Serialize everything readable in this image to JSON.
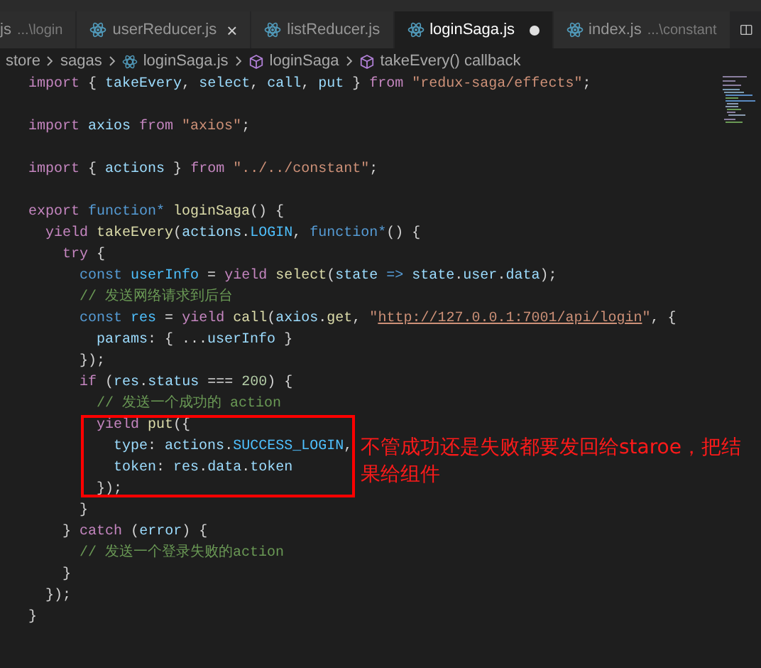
{
  "tabs": [
    {
      "label": "js",
      "path": "...\\login",
      "icon": false,
      "selected": false,
      "dirty": false
    },
    {
      "label": "userReducer.js",
      "icon": true,
      "close": "×",
      "selected": false,
      "dirty": false
    },
    {
      "label": "listReducer.js",
      "icon": true,
      "selected": false,
      "dirty": false
    },
    {
      "label": "loginSaga.js",
      "icon": true,
      "selected": true,
      "dirty": true
    },
    {
      "label": "index.js",
      "path": "...\\constant",
      "icon": true,
      "selected": false,
      "dirty": false
    }
  ],
  "breadcrumbs": [
    {
      "label": "store",
      "kind": "folder"
    },
    {
      "label": "sagas",
      "kind": "folder"
    },
    {
      "label": "loginSaga.js",
      "kind": "file"
    },
    {
      "label": "loginSaga",
      "kind": "symbol"
    },
    {
      "label": "takeEvery() callback",
      "kind": "symbol"
    }
  ],
  "code": [
    {
      "kind": "code",
      "tokens": [
        {
          "kind": "kw",
          "text": "import "
        },
        {
          "kind": "p",
          "text": "{ "
        },
        {
          "kind": "v",
          "text": "takeEvery"
        },
        {
          "kind": "p",
          "text": ", "
        },
        {
          "kind": "v",
          "text": "select"
        },
        {
          "kind": "p",
          "text": ", "
        },
        {
          "kind": "v",
          "text": "call"
        },
        {
          "kind": "p",
          "text": ", "
        },
        {
          "kind": "v",
          "text": "put"
        },
        {
          "kind": "p",
          "text": " } "
        },
        {
          "kind": "kw",
          "text": "from "
        },
        {
          "kind": "s",
          "text": "\"redux-saga/effects\""
        },
        {
          "kind": "p",
          "text": ";"
        }
      ]
    },
    {
      "kind": "blank"
    },
    {
      "kind": "code",
      "tokens": [
        {
          "kind": "kw",
          "text": "import "
        },
        {
          "kind": "v",
          "text": "axios "
        },
        {
          "kind": "kw",
          "text": "from "
        },
        {
          "kind": "s",
          "text": "\"axios\""
        },
        {
          "kind": "p",
          "text": ";"
        }
      ]
    },
    {
      "kind": "blank"
    },
    {
      "kind": "code",
      "tokens": [
        {
          "kind": "kw",
          "text": "import "
        },
        {
          "kind": "p",
          "text": "{ "
        },
        {
          "kind": "v",
          "text": "actions"
        },
        {
          "kind": "p",
          "text": " } "
        },
        {
          "kind": "kw",
          "text": "from "
        },
        {
          "kind": "s",
          "text": "\"../../constant\""
        },
        {
          "kind": "p",
          "text": ";"
        }
      ]
    },
    {
      "kind": "blank"
    },
    {
      "kind": "code",
      "tokens": [
        {
          "kind": "kw",
          "text": "export "
        },
        {
          "kind": "b",
          "text": "function* "
        },
        {
          "kind": "f",
          "text": "loginSaga"
        },
        {
          "kind": "p",
          "text": "() {"
        }
      ]
    },
    {
      "kind": "code",
      "tokens": [
        {
          "kind": "kw",
          "text": "  yield "
        },
        {
          "kind": "f",
          "text": "takeEvery"
        },
        {
          "kind": "p",
          "text": "("
        },
        {
          "kind": "v",
          "text": "actions"
        },
        {
          "kind": "p",
          "text": "."
        },
        {
          "kind": "c",
          "text": "LOGIN"
        },
        {
          "kind": "p",
          "text": ", "
        },
        {
          "kind": "b",
          "text": "function*"
        },
        {
          "kind": "p",
          "text": "() {"
        }
      ]
    },
    {
      "kind": "code",
      "tokens": [
        {
          "kind": "kw",
          "text": "    try"
        },
        {
          "kind": "p",
          "text": " {"
        }
      ]
    },
    {
      "kind": "code",
      "tokens": [
        {
          "kind": "b",
          "text": "      const "
        },
        {
          "kind": "c",
          "text": "userInfo"
        },
        {
          "kind": "p",
          "text": " = "
        },
        {
          "kind": "kw",
          "text": "yield "
        },
        {
          "kind": "f",
          "text": "select"
        },
        {
          "kind": "p",
          "text": "("
        },
        {
          "kind": "v",
          "text": "state "
        },
        {
          "kind": "b",
          "text": "=> "
        },
        {
          "kind": "v",
          "text": "state"
        },
        {
          "kind": "p",
          "text": "."
        },
        {
          "kind": "v",
          "text": "user"
        },
        {
          "kind": "p",
          "text": "."
        },
        {
          "kind": "v",
          "text": "data"
        },
        {
          "kind": "p",
          "text": ");"
        }
      ]
    },
    {
      "kind": "code",
      "tokens": [
        {
          "kind": "com",
          "text": "      // 发送网络请求到后台"
        }
      ]
    },
    {
      "kind": "code",
      "tokens": [
        {
          "kind": "b",
          "text": "      const "
        },
        {
          "kind": "c",
          "text": "res"
        },
        {
          "kind": "p",
          "text": " = "
        },
        {
          "kind": "kw",
          "text": "yield "
        },
        {
          "kind": "f",
          "text": "call"
        },
        {
          "kind": "p",
          "text": "("
        },
        {
          "kind": "v",
          "text": "axios"
        },
        {
          "kind": "p",
          "text": "."
        },
        {
          "kind": "f",
          "text": "get"
        },
        {
          "kind": "p",
          "text": ", "
        },
        {
          "kind": "s",
          "text": "\""
        },
        {
          "kind": "link",
          "text": "http://127.0.0.1:7001/api/login"
        },
        {
          "kind": "s",
          "text": "\""
        },
        {
          "kind": "p",
          "text": ", {"
        }
      ]
    },
    {
      "kind": "code",
      "tokens": [
        {
          "kind": "v",
          "text": "        params"
        },
        {
          "kind": "p",
          "text": ": { ..."
        },
        {
          "kind": "v",
          "text": "userInfo"
        },
        {
          "kind": "p",
          "text": " }"
        }
      ]
    },
    {
      "kind": "code",
      "tokens": [
        {
          "kind": "p",
          "text": "      });"
        }
      ]
    },
    {
      "kind": "code",
      "tokens": [
        {
          "kind": "kw",
          "text": "      if"
        },
        {
          "kind": "p",
          "text": " ("
        },
        {
          "kind": "v",
          "text": "res"
        },
        {
          "kind": "p",
          "text": "."
        },
        {
          "kind": "v",
          "text": "status"
        },
        {
          "kind": "p",
          "text": " === "
        },
        {
          "kind": "n",
          "text": "200"
        },
        {
          "kind": "p",
          "text": ") {"
        }
      ]
    },
    {
      "kind": "code",
      "tokens": [
        {
          "kind": "com",
          "text": "        // 发送一个成功的 action"
        }
      ]
    },
    {
      "kind": "code",
      "tokens": [
        {
          "kind": "kw",
          "text": "        yield "
        },
        {
          "kind": "f",
          "text": "put"
        },
        {
          "kind": "p",
          "text": "({"
        }
      ]
    },
    {
      "kind": "code",
      "tokens": [
        {
          "kind": "v",
          "text": "          type"
        },
        {
          "kind": "p",
          "text": ": "
        },
        {
          "kind": "v",
          "text": "actions"
        },
        {
          "kind": "p",
          "text": "."
        },
        {
          "kind": "c",
          "text": "SUCCESS_LOGIN"
        },
        {
          "kind": "p",
          "text": ","
        }
      ]
    },
    {
      "kind": "code",
      "tokens": [
        {
          "kind": "v",
          "text": "          token"
        },
        {
          "kind": "p",
          "text": ": "
        },
        {
          "kind": "v",
          "text": "res"
        },
        {
          "kind": "p",
          "text": "."
        },
        {
          "kind": "v",
          "text": "data"
        },
        {
          "kind": "p",
          "text": "."
        },
        {
          "kind": "v",
          "text": "token"
        }
      ]
    },
    {
      "kind": "code",
      "tokens": [
        {
          "kind": "p",
          "text": "        });"
        }
      ]
    },
    {
      "kind": "code",
      "tokens": [
        {
          "kind": "p",
          "text": "      }"
        }
      ]
    },
    {
      "kind": "code",
      "tokens": [
        {
          "kind": "p",
          "text": "    } "
        },
        {
          "kind": "kw",
          "text": "catch "
        },
        {
          "kind": "p",
          "text": "("
        },
        {
          "kind": "v",
          "text": "error"
        },
        {
          "kind": "p",
          "text": ") {"
        }
      ]
    },
    {
      "kind": "code",
      "tokens": [
        {
          "kind": "com",
          "text": "      // 发送一个登录失败的action"
        }
      ]
    },
    {
      "kind": "code",
      "tokens": [
        {
          "kind": "p",
          "text": "    }"
        }
      ]
    },
    {
      "kind": "code",
      "tokens": [
        {
          "kind": "p",
          "text": "  });"
        }
      ]
    },
    {
      "kind": "code",
      "tokens": [
        {
          "kind": "p",
          "text": "}"
        }
      ]
    }
  ],
  "annotation": {
    "text": "不管成功还是失败都要发回给staroe，把结果给组件"
  }
}
